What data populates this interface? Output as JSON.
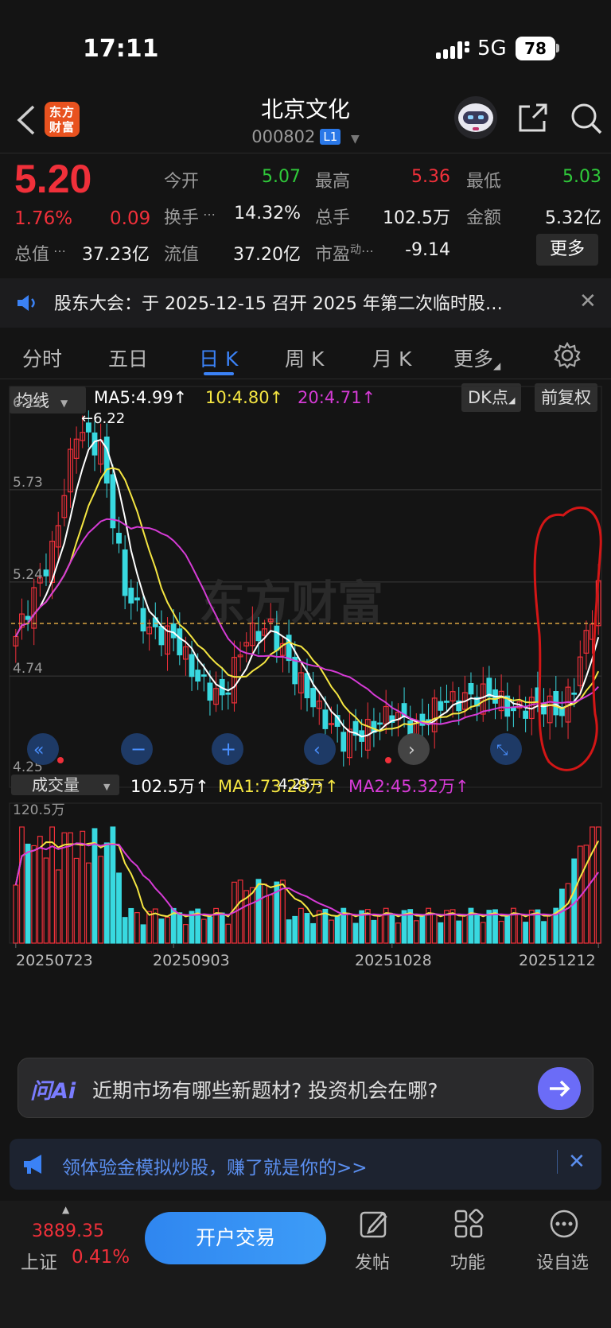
{
  "status": {
    "time": "17:11",
    "network": "5G",
    "battery": "78"
  },
  "header": {
    "logo_line1": "东方",
    "logo_line2": "财富",
    "stock_name": "北京文化",
    "stock_code": "000802",
    "level": "L1"
  },
  "quote": {
    "price": "5.20",
    "change_pct": "1.76%",
    "change": "0.09",
    "open_label": "今开",
    "open": "5.07",
    "high_label": "最高",
    "high": "5.36",
    "low_label": "最低",
    "low": "5.03",
    "turnover_label": "换手",
    "turnover": "14.32%",
    "volume_label": "总手",
    "volume": "102.5万",
    "amount_label": "金额",
    "amount": "5.32亿",
    "total_cap_label": "总值",
    "total_cap": "37.23亿",
    "float_cap_label": "流值",
    "float_cap": "37.20亿",
    "pe_label": "市盈",
    "pe_sup": "动",
    "pe": "-9.14",
    "more": "更多"
  },
  "notice": {
    "text": "股东大会：于 2025-12-15 召开 2025 年第二次临时股…"
  },
  "tabs": [
    "分时",
    "五日",
    "日 K",
    "周 K",
    "月 K",
    "更多"
  ],
  "chart": {
    "ma_selector": "均线",
    "ma5": "MA5:4.99↑",
    "ma10": "10:4.80↑",
    "ma20": "20:4.71↑",
    "dk": "DK点",
    "adjust": "前复权",
    "y_labels": [
      "6.22",
      "5.73",
      "5.24",
      "4.74",
      "4.25"
    ],
    "max_marker": "6.22",
    "min_marker": "4.25",
    "vol_selector": "成交量",
    "vol": "102.5万↑",
    "vol_ma1": "MA1:73.28万↑",
    "vol_ma2": "MA2:45.32万↑",
    "vol_max": "120.5万",
    "dates": [
      "20250723",
      "20250903",
      "20251028",
      "20251212"
    ],
    "watermark": "东方财富",
    "colors": {
      "up": "#f0303a",
      "down": "#38d9e0",
      "ma5": "#ffffff",
      "ma10": "#f5e642",
      "ma20": "#d63bd6"
    }
  },
  "ai": {
    "logo": "问Ai",
    "prompt": "近期市场有哪些新题材? 投资机会在哪?"
  },
  "promo": {
    "text": "领体验金模拟炒股，赚了就是你的>>"
  },
  "bottom": {
    "index_value": "3889.35",
    "index_name": "上证",
    "index_pct": "0.41%",
    "open_account": "开户交易",
    "nav": [
      "发帖",
      "功能",
      "设自选"
    ]
  }
}
